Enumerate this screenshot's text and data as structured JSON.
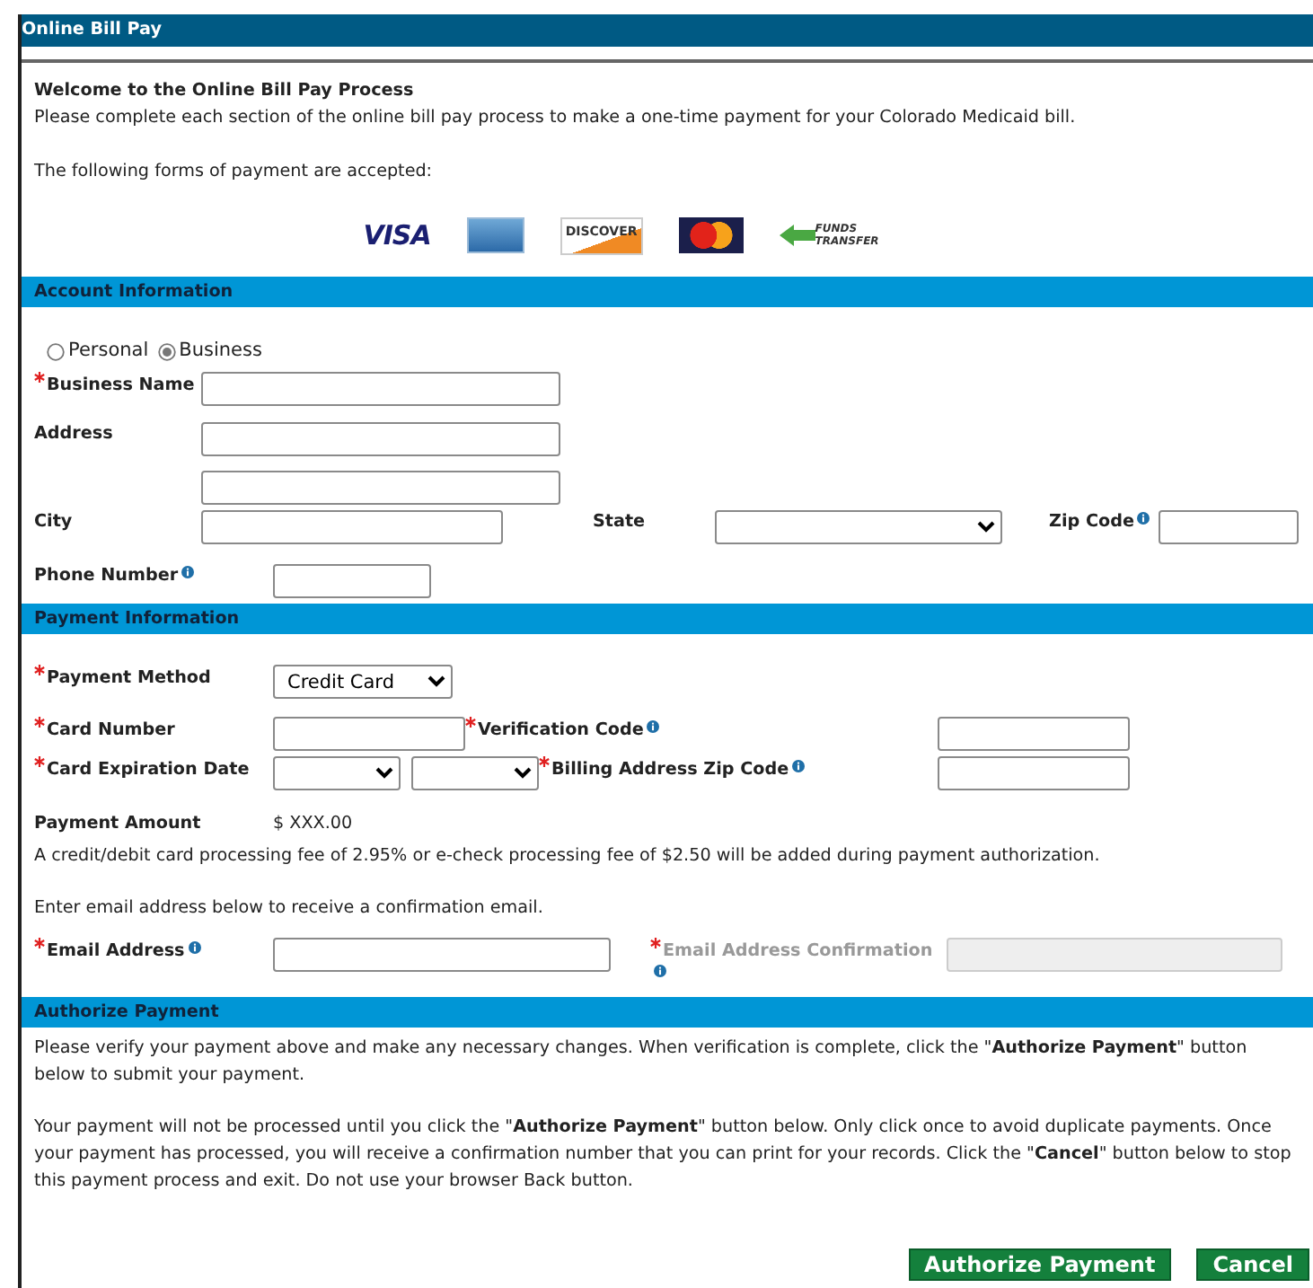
{
  "window": {
    "title": "Online Bill Pay"
  },
  "intro": {
    "heading": "Welcome to the Online Bill Pay Process",
    "text": "Please complete each section of the online bill pay process to make a one-time payment for your Colorado Medicaid bill.",
    "accepted_text": "The following forms of payment are accepted:"
  },
  "payment_logos": [
    {
      "kind": "visa",
      "label": "VISA"
    },
    {
      "kind": "amex"
    },
    {
      "kind": "discover",
      "label": "DISCOVER"
    },
    {
      "kind": "mastercard"
    },
    {
      "kind": "funds_transfer",
      "label": "FUNDS TRANSFER"
    }
  ],
  "account_information": {
    "title": "Account Information",
    "account_types": [
      {
        "label": "Personal",
        "selected": false
      },
      {
        "label": "Business",
        "selected": true
      }
    ],
    "business_name": {
      "label": "Business Name",
      "required": true
    },
    "address": {
      "label": "Address",
      "required": false
    },
    "city": {
      "label": "City",
      "required": false
    },
    "state": {
      "label": "State",
      "required": false
    },
    "zip_code": {
      "label": "Zip Code",
      "required": false,
      "info": true
    },
    "phone_number": {
      "label": "Phone Number",
      "required": false,
      "info": true
    }
  },
  "payment_information": {
    "title": "Payment Information",
    "payment_method": {
      "label": "Payment Method",
      "required": true,
      "value": "Credit Card"
    },
    "card_number": {
      "label": "Card Number",
      "required": true
    },
    "verification_code": {
      "label": "Verification Code",
      "required": true,
      "info": true
    },
    "card_expiration_date": {
      "label": "Card Expiration Date",
      "required": true
    },
    "billing_zip_code": {
      "label": "Billing Address Zip Code",
      "required": true,
      "info": true
    },
    "payment_amount": {
      "label": "Payment Amount",
      "value": "$ XXX.00"
    },
    "fee_text": "A credit/debit card processing fee of 2.95% or e-check processing fee of $2.50 will be added during payment authorization.",
    "email_prompt": "Enter email address below to receive a confirmation email.",
    "email_address": {
      "label": "Email Address",
      "required": true,
      "info": true,
      "disabled": false
    },
    "email_confirmation": {
      "label": "Email Address Confirmation",
      "required": true,
      "info": true,
      "disabled": true
    }
  },
  "authorize_payment": {
    "title": "Authorize Payment",
    "paragraphs": [
      "Please verify your payment above and make any necessary changes.  When verification is complete, click the \"**Authorize Payment**\" button below to submit your payment.",
      "Your payment will not be processed until you click the \"**Authorize Payment**\" button below.  Only click once to avoid duplicate payments.  Once your payment has processed, you will receive a confirmation number that you can print for your records.  Click the \"**Cancel**\" button below to stop this payment process and exit.  Do not use your browser Back button."
    ],
    "buttons": [
      "Authorize Payment",
      "Cancel"
    ]
  }
}
